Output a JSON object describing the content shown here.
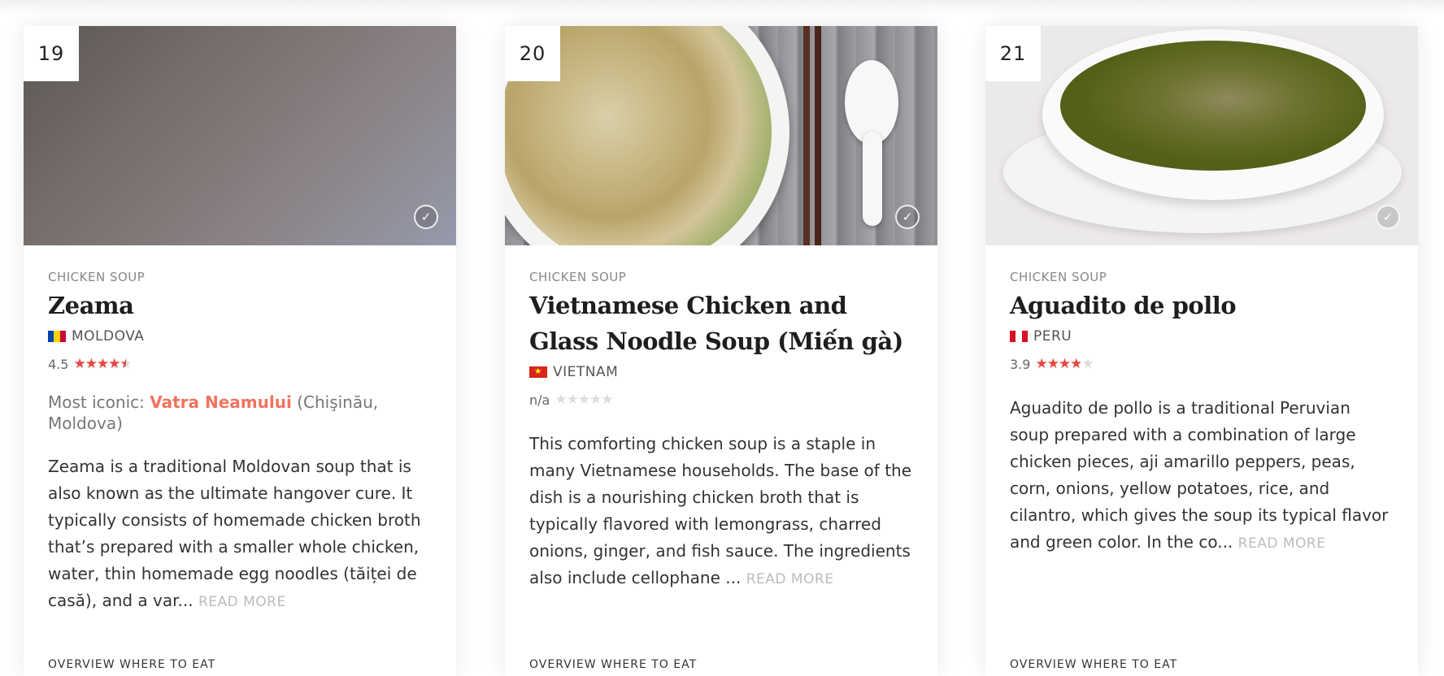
{
  "cards": [
    {
      "rank": "19",
      "category": "CHICKEN SOUP",
      "title": "Zeama",
      "country": "MOLDOVA",
      "rating_text": "4.5",
      "rating_value": 4.5,
      "iconic_prefix": "Most iconic:",
      "iconic_place": "Vatra Neamului",
      "iconic_suffix": "(Chişinău, Moldova)",
      "description": "Zeama is a traditional Moldovan soup that is also known as the ultimate hangover cure. It typically consists of homemade chicken broth that’s prepared with a smaller whole chicken, water, thin homemade egg noodles (tăiței de casă), and a var...",
      "read_more": "READ MORE",
      "footer": "OVERVIEW    WHERE TO EAT"
    },
    {
      "rank": "20",
      "category": "CHICKEN SOUP",
      "title": "Vietnamese Chicken and Glass Noodle Soup (Miến gà)",
      "country": "VIETNAM",
      "rating_text": "n/a",
      "rating_value": 0,
      "description": "This comforting chicken soup is a staple in many Vietnamese households. The base of the dish is a nourishing chicken broth that is typically flavored with lemongrass, charred onions, ginger, and fish sauce. The ingredients also include cellophane ...",
      "read_more": "READ MORE",
      "footer": "OVERVIEW    WHERE TO EAT"
    },
    {
      "rank": "21",
      "category": "CHICKEN SOUP",
      "title": "Aguadito de pollo",
      "country": "PERU",
      "rating_text": "3.9",
      "rating_value": 3.9,
      "description": "Aguadito de pollo is a traditional Peruvian soup prepared with a combination of large chicken pieces, aji amarillo peppers, peas, corn, onions, yellow potatoes, rice, and cilantro, which gives the soup its typical flavor and green color. In the co...",
      "read_more": "READ MORE",
      "footer": "OVERVIEW    WHERE TO EAT"
    }
  ],
  "icons": {
    "checkmark": "check-icon",
    "star": "star-icon"
  },
  "colors": {
    "star_active": "#e8473d",
    "star_inactive": "#dcdcdc",
    "iconic_link": "#f2735e"
  }
}
